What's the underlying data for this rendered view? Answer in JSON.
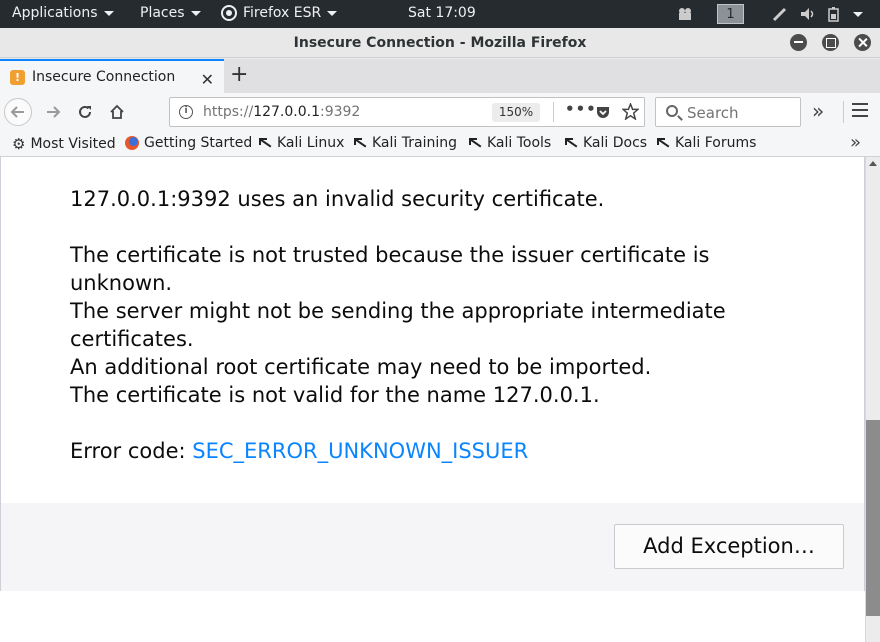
{
  "panel": {
    "applications": "Applications",
    "places": "Places",
    "firefox": "Firefox ESR",
    "clock": "Sat 17:09",
    "workspace": "1"
  },
  "window": {
    "title": "Insecure Connection - Mozilla Firefox"
  },
  "tab": {
    "label": "Insecure Connection",
    "favicon": "!"
  },
  "urlbar": {
    "scheme": "https://",
    "host": "127.0.0.1",
    "port": ":9392",
    "zoom": "150%"
  },
  "search": {
    "placeholder": "Search"
  },
  "bookmarks": [
    {
      "label": "Most Visited",
      "icon": "gear-icon"
    },
    {
      "label": "Getting Started",
      "icon": "firefox-icon"
    },
    {
      "label": "Kali Linux",
      "icon": "kali-icon"
    },
    {
      "label": "Kali Training",
      "icon": "kali-icon"
    },
    {
      "label": "Kali Tools",
      "icon": "kali-icon"
    },
    {
      "label": "Kali Docs",
      "icon": "kali-icon"
    },
    {
      "label": "Kali Forums",
      "icon": "kali-icon"
    }
  ],
  "error": {
    "headline": "127.0.0.1:9392 uses an invalid security certificate.",
    "line1": "The certificate is not trusted because the issuer certificate is unknown.",
    "line2": "The server might not be sending the appropriate intermediate certificates.",
    "line3": "An additional root certificate may need to be imported.",
    "line4": "The certificate is not valid for the name 127.0.0.1.",
    "code_label": "Error code: ",
    "code": "SEC_ERROR_UNKNOWN_ISSUER",
    "add_exception": "Add Exception…"
  },
  "colors": {
    "accent": "#0a84ff",
    "panel_bg": "#262b30"
  }
}
